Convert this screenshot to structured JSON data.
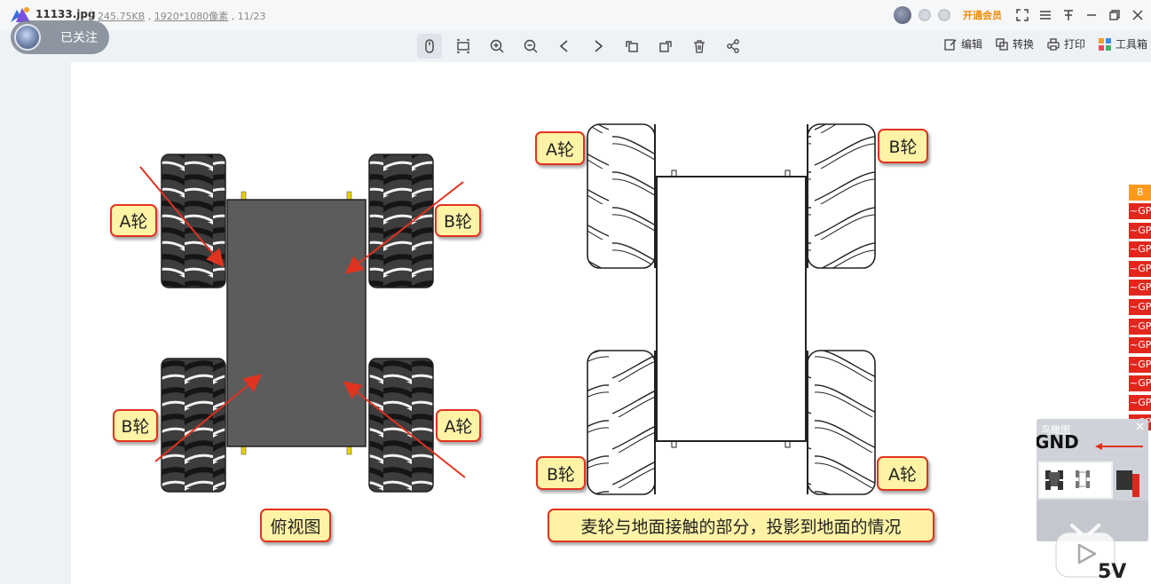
{
  "titlebar": {
    "file_name": "11133.jpg",
    "file_size": "245.75KB",
    "resolution": "1920*1080像素",
    "page_counter": "11/23",
    "vip_label": "开通会员"
  },
  "follow": {
    "label": "已关注"
  },
  "toolbar": {
    "tools": [
      "mouse-icon",
      "fit-screen-icon",
      "zoom-in-icon",
      "zoom-out-icon",
      "previous-icon",
      "next-icon",
      "rotate-left-icon",
      "rotate-right-icon",
      "delete-icon",
      "share-icon"
    ],
    "edit_label": "编辑",
    "convert_label": "转换",
    "print_label": "打印",
    "tools_label": "工具箱"
  },
  "diagram": {
    "left_labels": {
      "top_left": "A轮",
      "top_right": "B轮",
      "bottom_left": "B轮",
      "bottom_right": "A轮",
      "caption": "俯视图"
    },
    "right_labels": {
      "top_left": "A轮",
      "top_right": "B轮",
      "bottom_left": "B轮",
      "bottom_right": "A轮",
      "caption": "麦轮与地面接触的部分，投影到地面的情况"
    }
  },
  "side_panel": {
    "header": "B",
    "pins": [
      "~GP",
      "~GP",
      "~GP",
      "~GP",
      "~GP",
      "~GP",
      "~GP",
      "~GP",
      "~GP",
      "~GP",
      "~GP",
      "~GP"
    ]
  },
  "navigator": {
    "title": "鸟瞰图",
    "gnd_label": "GND"
  },
  "bottom_label": "5V",
  "colors": {
    "label_bg": "#fff3a6",
    "label_border": "#e0331f",
    "arrow": "#e0331f",
    "chassis": "#5c5c5c",
    "vip": "#f08a00"
  }
}
